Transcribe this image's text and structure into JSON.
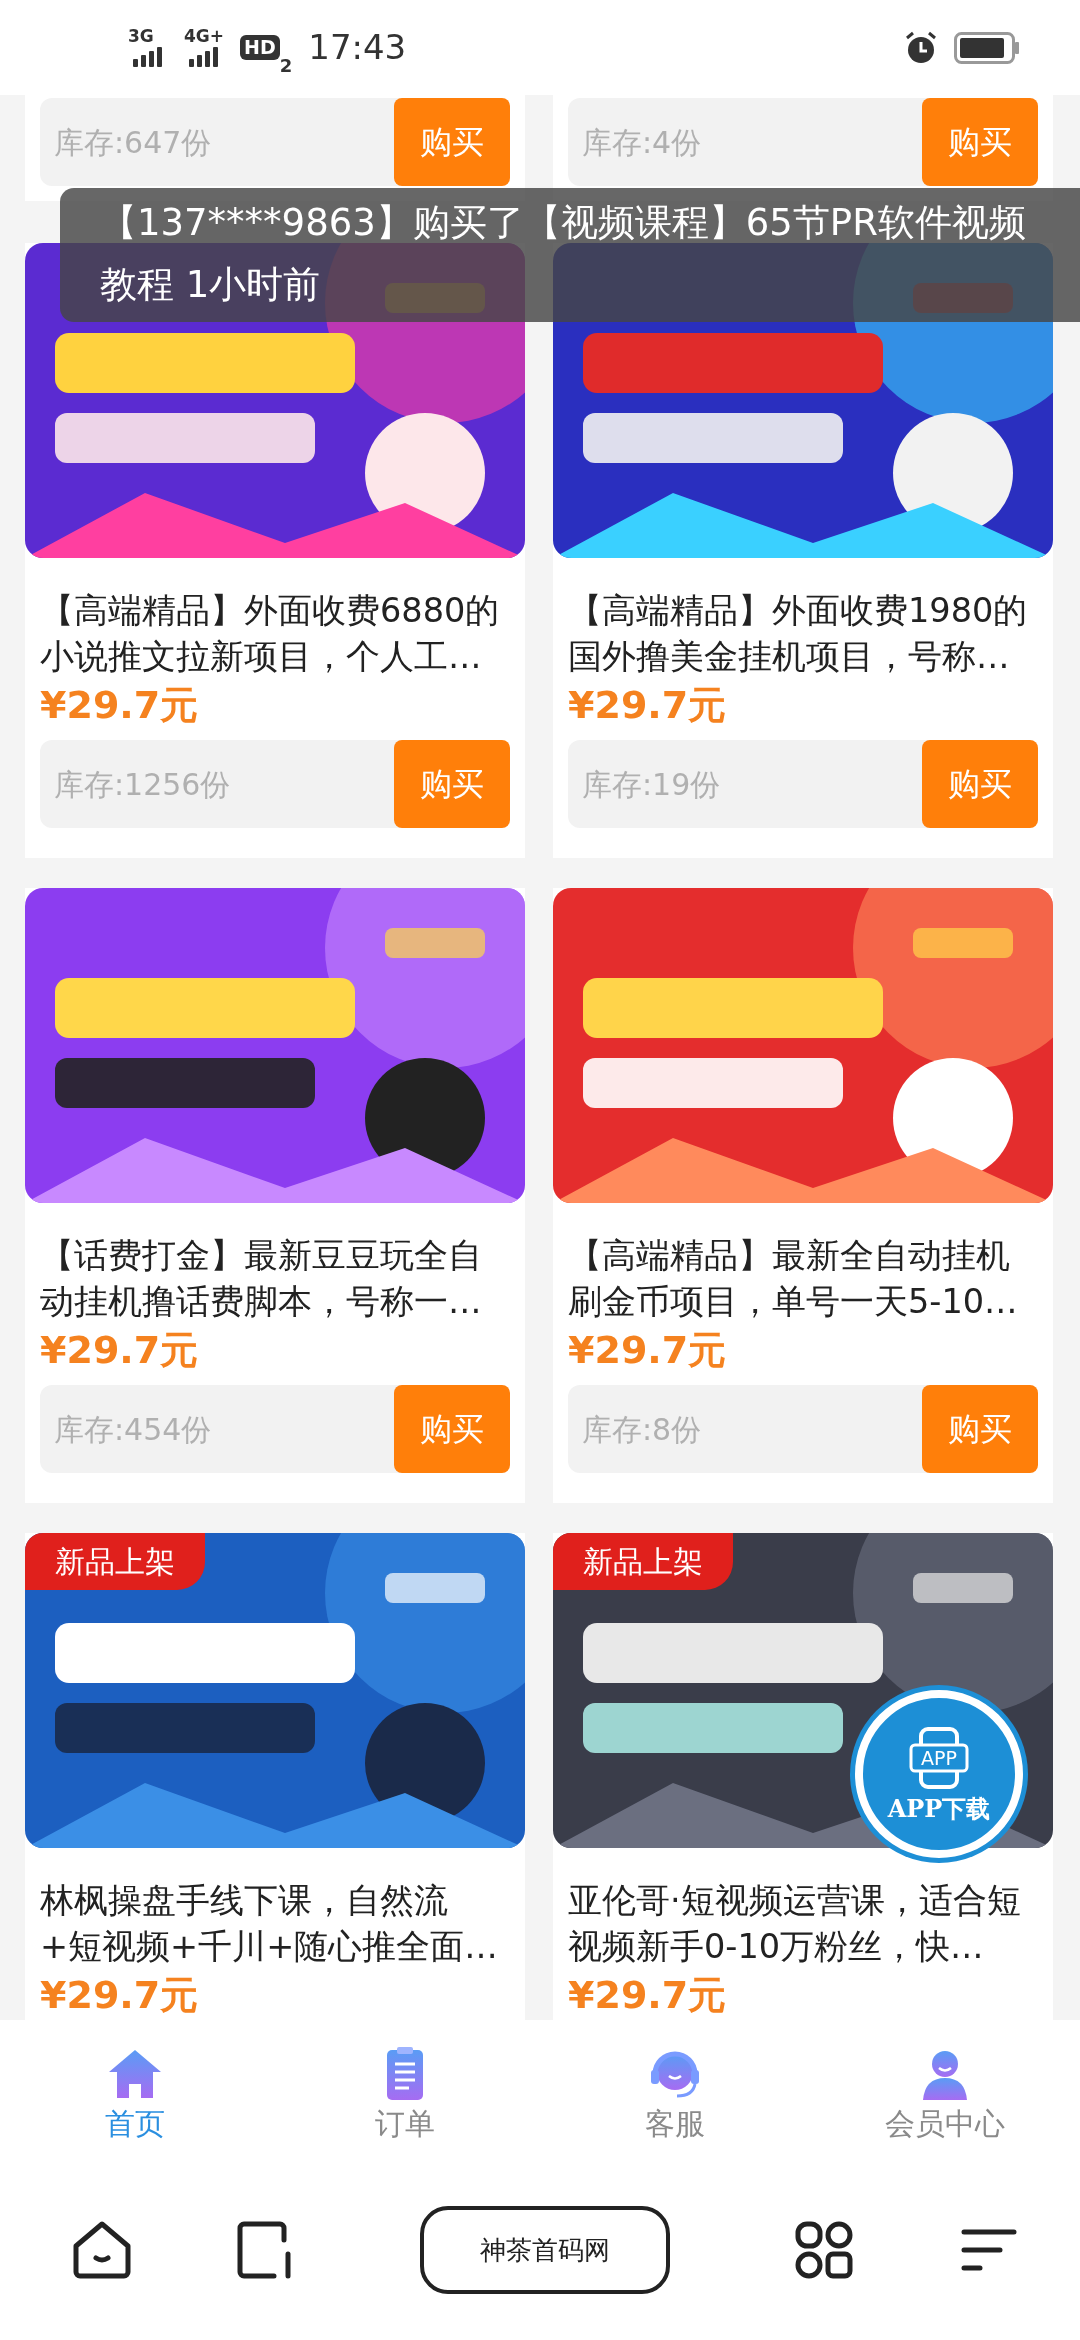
{
  "status_bar": {
    "networks": [
      "3G",
      "4G+"
    ],
    "hd_label": "HD",
    "hd_sub": "2",
    "time": "17:43"
  },
  "products": [
    {
      "kind": "partial",
      "stock": "库存:647份",
      "buy_label": "购买"
    },
    {
      "kind": "partial",
      "stock": "库存:4份",
      "buy_label": "购买"
    },
    {
      "kind": "full",
      "title": "【高端精品】外面收费6880的小说推文拉新项目，个人工…",
      "price": "¥29.7元",
      "stock": "库存:1256份",
      "buy_label": "购买"
    },
    {
      "kind": "full",
      "title": "【高端精品】外面收费1980的国外撸美金挂机项目，号称…",
      "price": "¥29.7元",
      "stock": "库存:19份",
      "buy_label": "购买"
    },
    {
      "kind": "full",
      "title": "【话费打金】最新豆豆玩全自动挂机撸话费脚本，号称一…",
      "price": "¥29.7元",
      "stock": "库存:454份",
      "buy_label": "购买"
    },
    {
      "kind": "full",
      "title": "【高端精品】最新全自动挂机刷金币项目，单号一天5-10…",
      "price": "¥29.7元",
      "stock": "库存:8份",
      "buy_label": "购买"
    },
    {
      "kind": "full",
      "badge": "新品上架",
      "title": "林枫操盘手线下课，自然流+短视频+千川+随心推全面…",
      "price": "¥29.7元"
    },
    {
      "kind": "full",
      "badge": "新品上架",
      "title": "亚伦哥·短视频运营课，适合短视频新手0-10万粉丝，快…",
      "price": "¥29.7元"
    }
  ],
  "toast": {
    "text": "【137****9863】购买了【视频课程】65节PR软件视频教程 1小时前"
  },
  "float_button": {
    "icon_label": "APP",
    "label": "APP下载"
  },
  "tabs": [
    {
      "label": "首页",
      "selected": true
    },
    {
      "label": "订单",
      "selected": false
    },
    {
      "label": "客服",
      "selected": false
    },
    {
      "label": "会员中心",
      "selected": false
    }
  ],
  "system_nav": {
    "center_label": "神茶首码网"
  }
}
